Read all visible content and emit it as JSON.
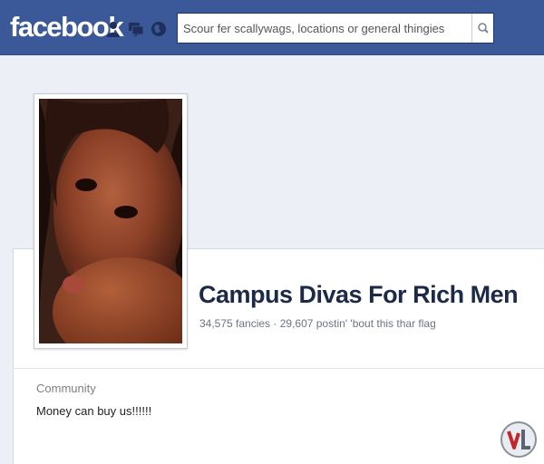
{
  "header": {
    "logo": "facebook",
    "search_placeholder": "Scour fer scallywags, locations or general thingies",
    "icons": [
      "friend-requests-icon",
      "messages-icon",
      "notifications-globe-icon",
      "search-icon"
    ]
  },
  "page": {
    "title": "Campus Divas For Rich Men",
    "stats": "34,575 fancies · 29,607 postin' 'bout this thar flag",
    "category": "Community",
    "about": "Money can buy us!!!!!!"
  },
  "colors": {
    "header_bg": "#3b5998",
    "page_bg": "#eceff5",
    "title_color": "#1c2a47"
  }
}
